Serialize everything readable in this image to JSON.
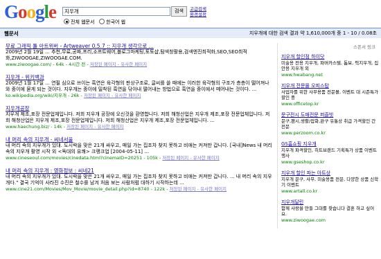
{
  "logo": {
    "letters": [
      "G",
      "o",
      "o",
      "g",
      "l",
      "e"
    ],
    "colors": [
      "#2f60d8",
      "#d53a2b",
      "#f0b31b",
      "#2f60d8",
      "#2e9a3b",
      "#d53a2b"
    ]
  },
  "search": {
    "query": "지우개",
    "button": "검색",
    "adv_links": [
      "고급검색",
      "환경설정"
    ]
  },
  "radios": [
    {
      "label": "전체 웹문서",
      "checked": true
    },
    {
      "label": "한국어 웹",
      "checked": false
    }
  ],
  "bar": {
    "left": "웹문서",
    "right": "지우개에 대한 검색 결과 약 1,610,000개 중 1 - 10 / 0.08초"
  },
  "results": [
    {
      "title": "무료 그래픽 툴 아트위버 - Artweaver 0.5.7 :: 지우개 생각으로 ...",
      "snippet": "2009년 2월 19일 ... 추천,무료,공짜,프리,소프트웨어,블로그마케팅,토토샵,탐색창활용,검색엔진최적화,SEO,SEO최적화,ZIWOOGAE,ZIWOOGAE.COM.",
      "url": "www.ziwoogae.com/ - 64k - 4시간 전 - ",
      "links": "저장된 페이지 - 유사한 페이지"
    },
    {
      "title": "지우개 - 위키백과",
      "snippet": "2009년 1월 17일 ... 연필 심으로 쓰이는 흑연은 육각형의 판상구조로, 글씨를 쓸 때에는 이러한 육각형의 구조가 층층이 떨어져나와 종이에 묻게 되는 것이다. 지우개는 종이에 밀착된 흑연을 닦아내 떨어내는 방법으로 흑연을 종이에서 떼어내는 것이다. ...",
      "url": "ko.wikipedia.org/wiki/지우개 - 26k - ",
      "links": "저장된 페이지 - 유사한 페이지"
    },
    {
      "title": "지우개공장",
      "snippet": "지우개 제조,포장 전문업체입니다. 저희 지우개 공장에 오신것을 환영합니다. 저희 해청산업은 지우개 제조,포장 전문업체입니다. 저희 해청산업은 지우개 제조,포장 전문업체입니다. 저희 해청산업은 지우개 제조,포장 전문업체입니다. ...",
      "url": "www.haechung.biz/ - 14k - ",
      "links": "저장된 페이지 - 유사한 페이지"
    },
    {
      "title": "내 머리 속의 지우개 - 씨네서울",
      "snippet": "내 머리 속의 지우개가 있대. 도시락을 맞은 21개 싸우고, 매일 가는 집조차 찾지 못하고 비애는 커져만 갑니다. [국내]News 내 머리속의 지우개 활영 시작 외 <독대의 유쾌> 크랭크업 [2004-05-11] ...",
      "url": "www.cineseoul.com/movies/cinedata.html?cinemaID=20251 - 105k - ",
      "links": "저장된 페이지 - 유사한 페이지"
    },
    {
      "title": "내 머리 속의 지우개 : 영화정보 : 씨네21",
      "snippet": "내 머리 속의 지우개가 있대. 도시락을 맞은 21개 싸우고, 매일 가는 집조차 찾지 못하고 비애는 커져만 갑니다. ... 내 머리 속의 지우개다.\" 결국 기억이 사라진 수진은 철수를 남겨 처음 보는 사람처럼 대하기 시작하는데 ...",
      "url": "www.cine21.com/Movies/Mov_Movie/movie_detail.php?id=8740 - 122k - ",
      "links": "저장된 페이지 - 유사한 페이지"
    }
  ],
  "sidebar": {
    "header": "스폰서 링크",
    "ads": [
      {
        "title": "지우개 할인점 하이닷",
        "desc": "미술용 전용 지우개, 파버카스텔, 톰보, 픽지우개, 집안용 지우개 외",
        "url": "www.hwabang.net"
      },
      {
        "title": "지우개 전문몰 오피스탑",
        "desc": "사업자를 위한 사무용품 전문몰, 이벤트 대 시즌특가 할인 중",
        "url": "www.officetop.kr"
      },
      {
        "title": "문구전시 도매전문 퍼즐빗",
        "desc": "문구,팬시,생활/잡화,완구 유통상 취급 가격할인 간 전문",
        "url": "www.perzoom.co.kr"
      },
      {
        "title": "GS홈쇼핑 지우개",
        "desc": "지우개 파격할인, 히트브랜드 기획특가 상품 이벤트 행사",
        "url": "www.gseshop.co.kr"
      },
      {
        "title": "지우개 할인 파는 아트상",
        "desc": "지우개 문구, 사무, 미술용품 전문, 다양한 상품 신학기 이벤트",
        "url": "www.artall.co.kr"
      },
      {
        "title": "지우개달린",
        "desc": "함께 사랑을 만들 그대를 찾습니다 결혼 하고 싶어요.",
        "url": "www.ziwoogae.com"
      }
    ]
  }
}
